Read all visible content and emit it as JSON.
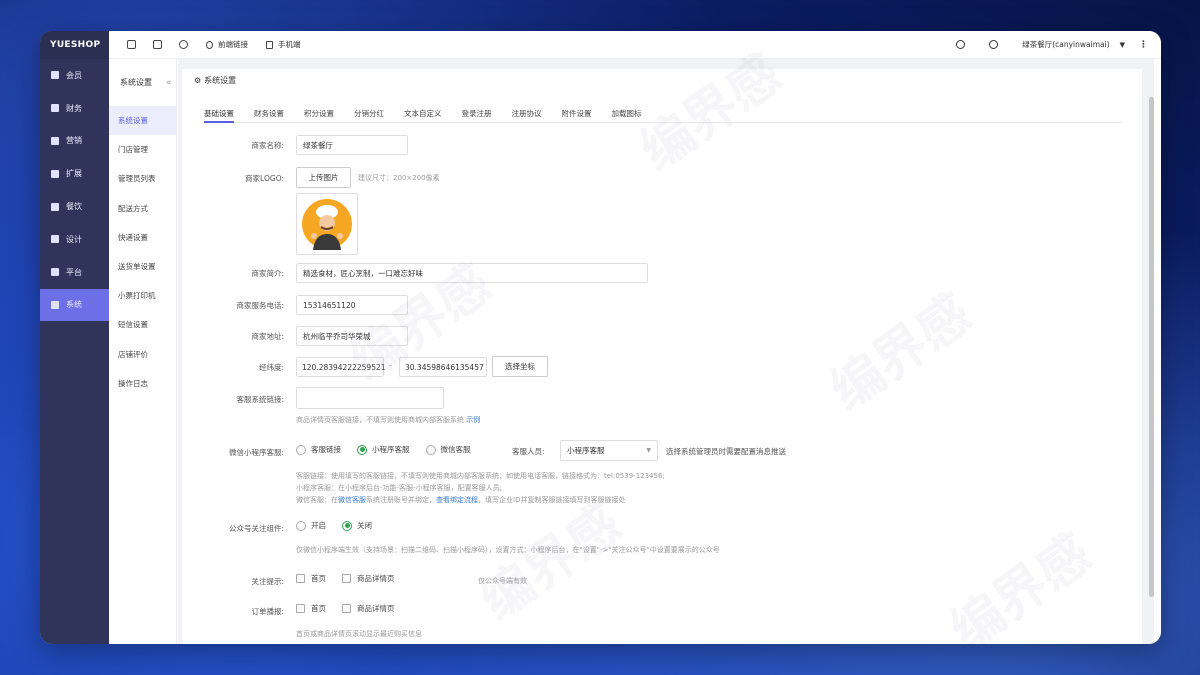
{
  "brand": "YUESHOP",
  "nav": [
    {
      "label": "会员",
      "icon": "user-icon"
    },
    {
      "label": "财务",
      "icon": "wallet-icon"
    },
    {
      "label": "营销",
      "icon": "megaphone-icon"
    },
    {
      "label": "扩展",
      "icon": "cube-icon"
    },
    {
      "label": "餐饮",
      "icon": "dish-icon"
    },
    {
      "label": "设计",
      "icon": "puzzle-icon"
    },
    {
      "label": "平台",
      "icon": "grid-icon"
    },
    {
      "label": "系统",
      "icon": "monitor-icon",
      "active": true
    }
  ],
  "subnav": {
    "title": "系统设置",
    "items": [
      "系统设置",
      "门店管理",
      "管理员列表",
      "配送方式",
      "快递设置",
      "送货单设置",
      "小票打印机",
      "短信设置",
      "店铺评价",
      "操作日志"
    ]
  },
  "topbar": {
    "front_link": "前端链接",
    "mobile": "手机端",
    "user": "绿茶餐厅(canyinwaimai)"
  },
  "panel": {
    "title": "系统设置",
    "tabs": [
      "基础设置",
      "财务设置",
      "积分设置",
      "分销分红",
      "文本自定义",
      "登录注册",
      "注册协议",
      "附件设置",
      "加载图标"
    ]
  },
  "form": {
    "name_label": "商家名称:",
    "name_value": "绿茶餐厅",
    "logo_label": "商家LOGO:",
    "upload_btn": "上传图片",
    "logo_hint": "建议尺寸：200×200像素",
    "intro_label": "商家简介:",
    "intro_value": "精选食材，匠心烹制，一口难忘好味",
    "phone_label": "商家服务电话:",
    "phone_value": "15314651120",
    "address_label": "商家地址:",
    "address_value": "杭州临平乔司华荣城",
    "latlng_label": "经纬度:",
    "lng_value": "120.28394222259521",
    "lat_value": "30.34598646135457",
    "latlng_sep": "-",
    "pick_btn": "选择坐标",
    "cs_link_label": "客服系统链接:",
    "cs_link_hint": "商品详情页客服链接，不填写则使用商城内部客服系统",
    "cs_link_example": "示例",
    "mini_cs_label": "微信小程序客服:",
    "mini_cs_options": [
      "客服链接",
      "小程序客服",
      "微信客服"
    ],
    "staff_label": "客服人员:",
    "staff_value": "小程序客服",
    "staff_hint": "选择系统管理员时需要配置消息推送",
    "mini_hint1": "客服链接：使用填写的客服链接，不填写则使用商城内部客服系统；如使用电话客服，链接格式为：tel:0539-123456;",
    "mini_hint2": "小程序客服：在小程序后台-功能-客服-小程序客服，配置客服人员;",
    "mini_hint3a": "微信客服：在",
    "mini_hint3_link": "微信客服",
    "mini_hint3b": "系统注册账号并绑定，",
    "mini_hint3_link2": "查看绑定流程",
    "mini_hint3c": "，填写企业ID并复制客服链接填写到客服链接处",
    "follow_label": "公众号关注组件:",
    "follow_options": [
      "开启",
      "关闭"
    ],
    "follow_hint": "仅微信小程序端生效（支持场景：扫描二维码、扫描小程序码），设置方式：小程序后台，在\"设置\"->\"关注公众号\"中设置要展示的公众号",
    "tip_label": "关注提示:",
    "tip_options": [
      "首页",
      "商品详情页"
    ],
    "tip_hint": "仅公众号端有效",
    "order_label": "订单播报:",
    "order_options": [
      "首页",
      "商品详情页"
    ],
    "order_hint": "首页或商品详情页滚动显示最近购买信息"
  },
  "watermark": "编界感"
}
